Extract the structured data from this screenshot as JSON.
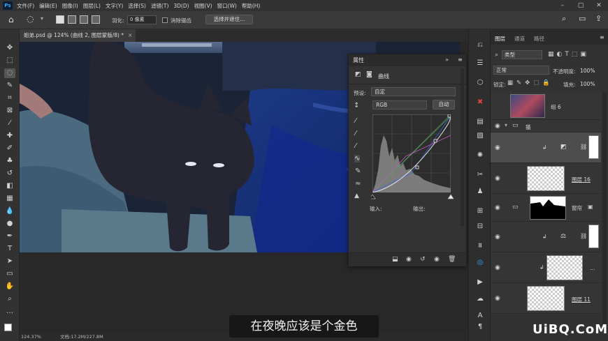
{
  "menubar": {
    "app_icon": "Ps",
    "items": [
      "文件(F)",
      "编辑(E)",
      "图像(I)",
      "图层(L)",
      "文字(Y)",
      "选择(S)",
      "滤镜(T)",
      "3D(D)",
      "视图(V)",
      "窗口(W)",
      "帮助(H)"
    ]
  },
  "options": {
    "feather_label": "羽化:",
    "feather_value": "0 像素",
    "antialias_label": "消除锯齿",
    "select_mask_button": "选择并遮住..."
  },
  "document": {
    "tab_title": "姐弟.psd @ 124% (曲线 2, 图层蒙版/8) *",
    "zoom": "124.37%",
    "doc_size": "文档:17.2M/227.8M"
  },
  "subtitle": "在夜晚应该是个金色",
  "properties": {
    "title": "属性",
    "adjustment_name": "曲线",
    "preset_label": "预设:",
    "preset_value": "自定",
    "channel_value": "RGB",
    "auto_button": "自动",
    "input_label": "输入:",
    "output_label": "输出:"
  },
  "layers_panel": {
    "tabs": [
      "图层",
      "通道",
      "路径"
    ],
    "filter_kind": "类型",
    "blend_mode": "正常",
    "opacity_label": "不透明度:",
    "opacity_value": "100%",
    "lock_label": "锁定:",
    "fill_label": "填充:",
    "fill_value": "100%",
    "layers": [
      {
        "name": "组 6"
      },
      {
        "name": "猫"
      },
      {
        "name": ""
      },
      {
        "name": "图层 16"
      },
      {
        "name": "窗帘"
      },
      {
        "name": ""
      },
      {
        "name": "..."
      },
      {
        "name": "图层 11"
      }
    ]
  },
  "watermark": "UiBQ.CoM",
  "colors": {
    "accent": "#31a8ff",
    "panel": "#323232",
    "curve_line": "#e8e8e8"
  }
}
